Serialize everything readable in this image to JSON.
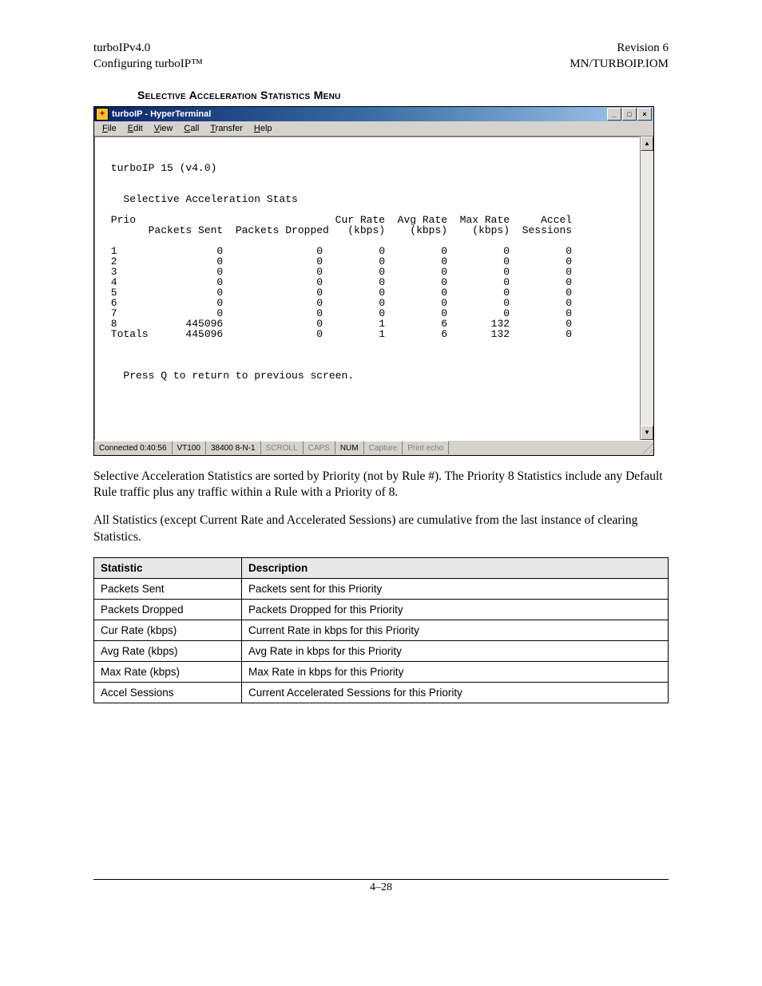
{
  "header": {
    "left1": "turboIPv4.0",
    "left2": "Configuring turboIP™",
    "right1": "Revision 6",
    "right2": "MN/TURBOIP.IOM"
  },
  "section_title": "Selective Acceleration Statistics Menu",
  "window": {
    "title": "turboIP - HyperTerminal",
    "menubar": [
      "File",
      "Edit",
      "View",
      "Call",
      "Transfer",
      "Help"
    ],
    "terminal": {
      "title_line": " turboIP 15 (v4.0)",
      "subtitle": "   Selective Acceleration Stats",
      "cols": [
        "Prio",
        "Packets Sent",
        "Packets Dropped",
        "Cur Rate (kbps)",
        "Avg Rate (kbps)",
        "Max Rate (kbps)",
        "Accel Sessions"
      ],
      "rows": [
        {
          "prio": "1",
          "sent": "0",
          "drop": "0",
          "cur": "0",
          "avg": "0",
          "max": "0",
          "sess": "0"
        },
        {
          "prio": "2",
          "sent": "0",
          "drop": "0",
          "cur": "0",
          "avg": "0",
          "max": "0",
          "sess": "0"
        },
        {
          "prio": "3",
          "sent": "0",
          "drop": "0",
          "cur": "0",
          "avg": "0",
          "max": "0",
          "sess": "0"
        },
        {
          "prio": "4",
          "sent": "0",
          "drop": "0",
          "cur": "0",
          "avg": "0",
          "max": "0",
          "sess": "0"
        },
        {
          "prio": "5",
          "sent": "0",
          "drop": "0",
          "cur": "0",
          "avg": "0",
          "max": "0",
          "sess": "0"
        },
        {
          "prio": "6",
          "sent": "0",
          "drop": "0",
          "cur": "0",
          "avg": "0",
          "max": "0",
          "sess": "0"
        },
        {
          "prio": "7",
          "sent": "0",
          "drop": "0",
          "cur": "0",
          "avg": "0",
          "max": "0",
          "sess": "0"
        },
        {
          "prio": "8",
          "sent": "445096",
          "drop": "0",
          "cur": "1",
          "avg": "6",
          "max": "132",
          "sess": "0"
        },
        {
          "prio": "Totals",
          "sent": "445096",
          "drop": "0",
          "cur": "1",
          "avg": "6",
          "max": "132",
          "sess": "0"
        }
      ],
      "prompt": "   Press Q to return to previous screen."
    },
    "statusbar": {
      "connected": "Connected 0:40:56",
      "emul": "VT100",
      "port": "38400 8-N-1",
      "scroll": "SCROLL",
      "caps": "CAPS",
      "num": "NUM",
      "capture": "Capture",
      "printecho": "Print echo"
    }
  },
  "para1": "Selective Acceleration Statistics are sorted by Priority (not by Rule #). The Priority 8 Statistics include any Default Rule traffic plus any traffic within a Rule with a Priority of 8.",
  "para2": "All Statistics (except Current Rate and Accelerated Sessions) are cumulative from the last instance of clearing Statistics.",
  "def_table": {
    "headers": [
      "Statistic",
      "Description"
    ],
    "rows": [
      [
        "Packets Sent",
        "Packets sent for this Priority"
      ],
      [
        "Packets Dropped",
        "Packets Dropped for this Priority"
      ],
      [
        "Cur Rate (kbps)",
        "Current Rate in kbps for this Priority"
      ],
      [
        "Avg Rate (kbps)",
        "Avg Rate in kbps for this Priority"
      ],
      [
        "Max Rate (kbps)",
        "Max Rate in kbps for this Priority"
      ],
      [
        "Accel Sessions",
        "Current Accelerated Sessions for this Priority"
      ]
    ]
  },
  "footer": "4–28"
}
